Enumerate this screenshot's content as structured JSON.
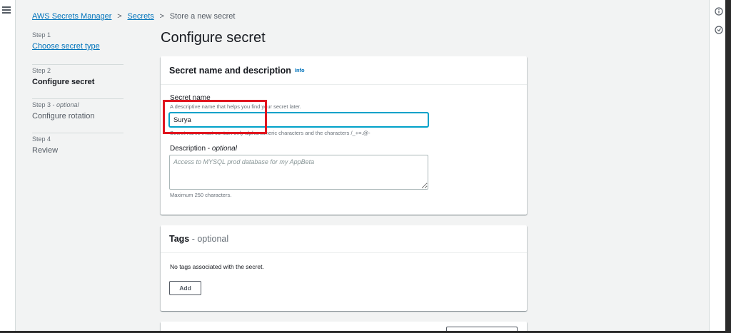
{
  "breadcrumb": {
    "items": [
      {
        "label": "AWS Secrets Manager",
        "link": true
      },
      {
        "label": "Secrets",
        "link": true
      },
      {
        "label": "Store a new secret",
        "link": false
      }
    ],
    "separator": ">"
  },
  "steps": [
    {
      "number": "Step 1",
      "optional": "",
      "title": "Choose secret type",
      "state": "link"
    },
    {
      "number": "Step 2",
      "optional": "",
      "title": "Configure secret",
      "state": "active"
    },
    {
      "number": "Step 3 - ",
      "optional": "optional",
      "title": "Configure rotation",
      "state": "inactive"
    },
    {
      "number": "Step 4",
      "optional": "",
      "title": "Review",
      "state": "inactive"
    }
  ],
  "page_title": "Configure secret",
  "name_section": {
    "title": "Secret name and description",
    "info_label": "Info",
    "secret_name_label": "Secret name",
    "secret_name_description": "A descriptive name that helps you find your secret later.",
    "secret_name_value": "Surya",
    "secret_name_constraint": "Secret name must contain only alphanumeric characters and the characters /_+=.@-",
    "description_label": "Description - ",
    "description_optional": "optional",
    "description_placeholder": "Access to MYSQL prod database for my AppBeta",
    "description_constraint": "Maximum 250 characters."
  },
  "tags_section": {
    "title": "Tags",
    "optional_suffix": " - optional",
    "empty_text": "No tags associated with the secret.",
    "add_label": "Add"
  },
  "colors": {
    "link": "#0073bb",
    "focus": "#00a1c9",
    "highlight": "#e0151f",
    "background": "#f2f3f3"
  },
  "icons": {
    "menu": "hamburger-icon",
    "info": "info-circle-icon",
    "notifications": "notification-icon"
  }
}
